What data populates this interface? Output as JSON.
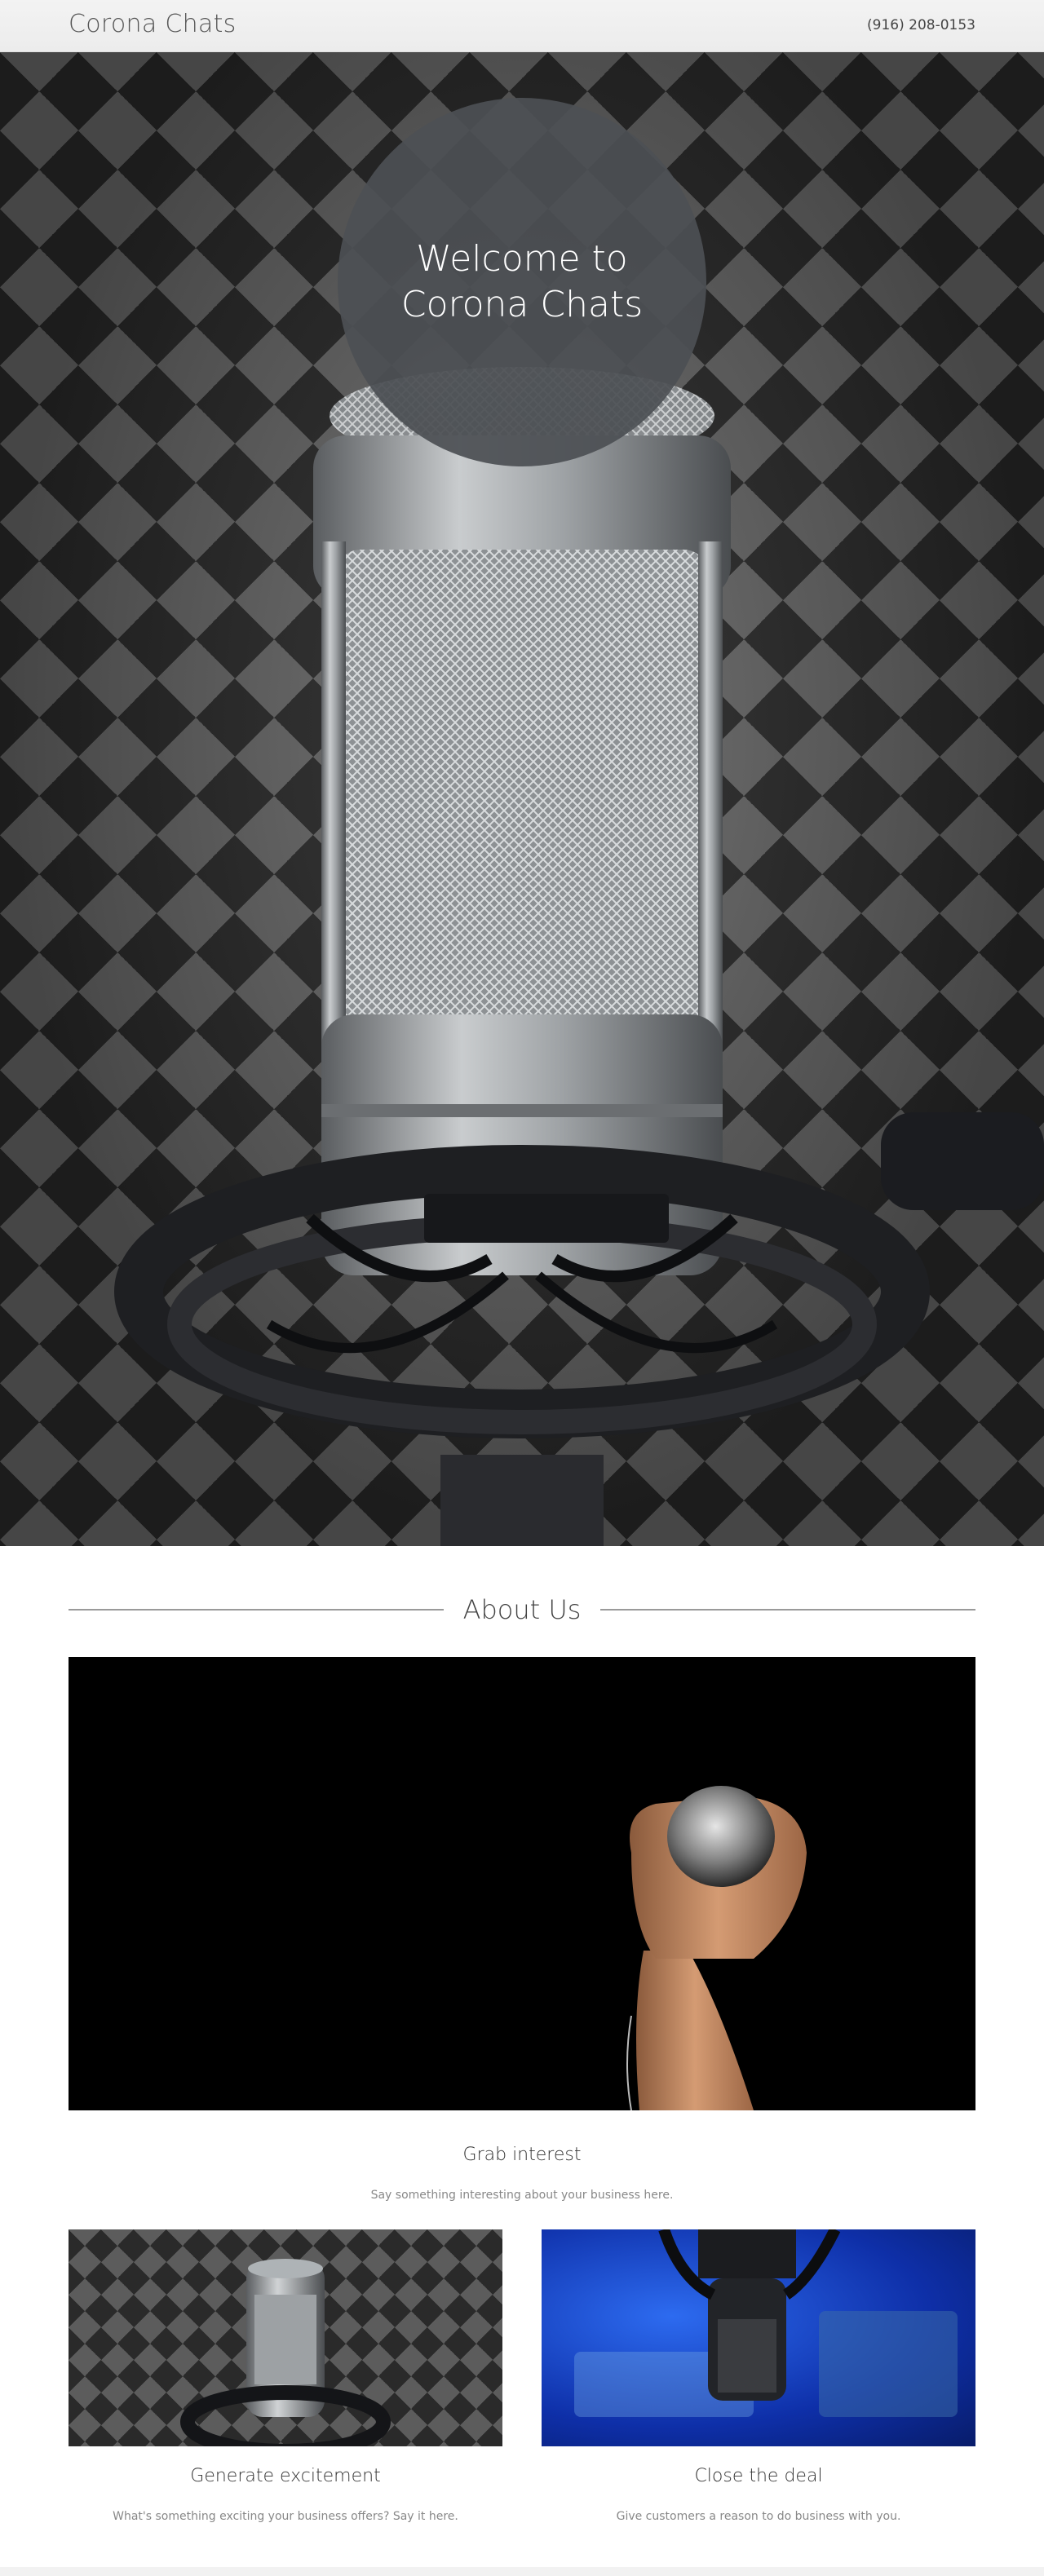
{
  "header": {
    "brand": "Corona Chats",
    "phone": "(916) 208-0153"
  },
  "hero": {
    "title": "Welcome to\nCorona Chats"
  },
  "about": {
    "heading": "About Us",
    "main_feature": {
      "title": "Grab interest",
      "text": "Say something interesting about your business here."
    },
    "cards": [
      {
        "title": "Generate excitement",
        "text": "What's something exciting your business offers? Say it here."
      },
      {
        "title": "Close the deal",
        "text": "Give customers a reason to do business with you."
      }
    ]
  },
  "colors": {
    "hero_overlay": "#4c5054",
    "text_dark": "#444444",
    "text_muted": "#888888",
    "rule": "#9a9a9a"
  }
}
